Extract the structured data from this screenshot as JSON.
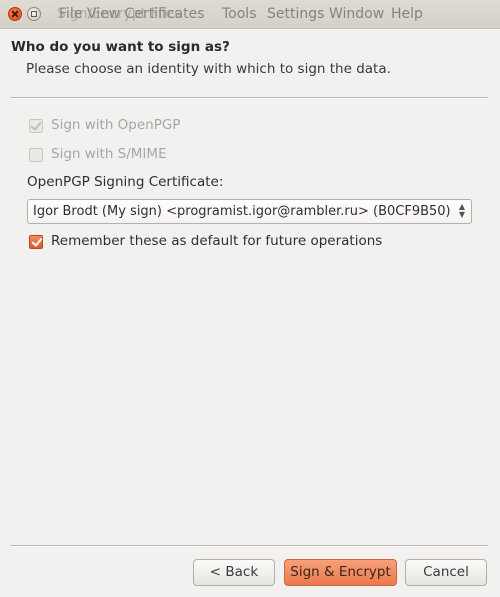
{
  "titlebar": {
    "overlapped_title_a": "Sign/Encrypt Files",
    "overlapped_title_b": "File  View  Certificates",
    "menu": [
      "Tools",
      "Settings",
      "Window",
      "Help"
    ]
  },
  "dialog": {
    "heading": "Who do you want to sign as?",
    "subheading": "Please choose an identity with which to sign the data.",
    "options": [
      {
        "label": "Sign with OpenPGP",
        "checked": true,
        "enabled": false
      },
      {
        "label": "Sign with S/MIME",
        "checked": false,
        "enabled": false
      }
    ],
    "certificate_label": "OpenPGP Signing Certificate:",
    "certificate_value": "Igor Brodt (My sign) <programist.igor@rambler.ru> (B0CF9B50)",
    "remember_label": "Remember these as default for future operations",
    "remember_checked": true
  },
  "buttons": {
    "back": "< Back",
    "sign_encrypt": "Sign & Encrypt",
    "cancel": "Cancel"
  },
  "colors": {
    "accent": "#ea7a4c",
    "background": "#f2f1f0"
  }
}
